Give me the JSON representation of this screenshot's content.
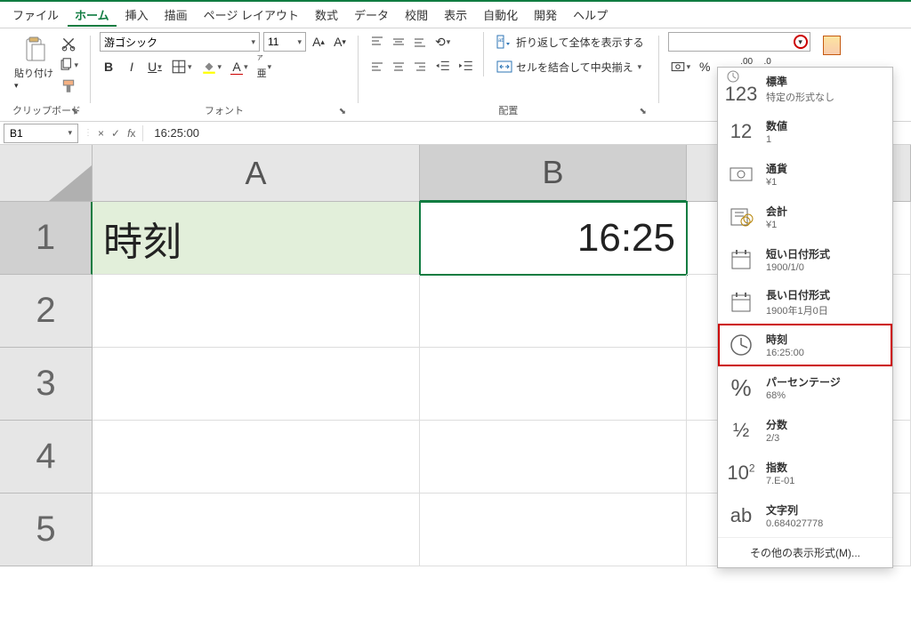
{
  "menu": {
    "file": "ファイル",
    "home": "ホーム",
    "insert": "挿入",
    "draw": "描画",
    "layout": "ページ レイアウト",
    "formulas": "数式",
    "data": "データ",
    "review": "校閲",
    "view": "表示",
    "automate": "自動化",
    "developer": "開発",
    "help": "ヘルプ"
  },
  "ribbon": {
    "paste_label": "貼り付け",
    "clipboard_label": "クリップボード",
    "font_name": "游ゴシック",
    "font_size": "11",
    "font_label": "フォント",
    "align_label": "配置",
    "wrap_text": "折り返して全体を表示する",
    "merge_center": "セルを結合して中央揃え"
  },
  "formula_bar": {
    "name_box": "B1",
    "formula": "16:25:00"
  },
  "grid": {
    "cols": [
      "A",
      "B"
    ],
    "rows": [
      "1",
      "2",
      "3",
      "4",
      "5"
    ],
    "A1": "時刻",
    "B1": "16:25"
  },
  "number_formats": [
    {
      "icon": "123",
      "title": "標準",
      "sample": "特定の形式なし"
    },
    {
      "icon": "12",
      "title": "数値",
      "sample": "1"
    },
    {
      "icon": "cur",
      "title": "通貨",
      "sample": "¥1"
    },
    {
      "icon": "acc",
      "title": "会計",
      "sample": " ¥1"
    },
    {
      "icon": "sdate",
      "title": "短い日付形式",
      "sample": "1900/1/0"
    },
    {
      "icon": "ldate",
      "title": "長い日付形式",
      "sample": "1900年1月0日"
    },
    {
      "icon": "time",
      "title": "時刻",
      "sample": "16:25:00"
    },
    {
      "icon": "pct",
      "title": "パーセンテージ",
      "sample": "68%"
    },
    {
      "icon": "frac",
      "title": "分数",
      "sample": " 2/3"
    },
    {
      "icon": "sci",
      "title": "指数",
      "sample": "7.E-01"
    },
    {
      "icon": "text",
      "title": "文字列",
      "sample": "0.684027778"
    }
  ],
  "number_formats_footer": "その他の表示形式(M)...",
  "highlighted_format_index": 6
}
